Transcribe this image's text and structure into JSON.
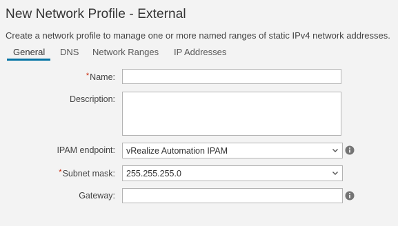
{
  "dialog": {
    "title": "New Network Profile - External",
    "subtitle": "Create a network profile to manage one or more named ranges of static IPv4 network addresses."
  },
  "tabs": [
    {
      "label": "General",
      "active": true
    },
    {
      "label": "DNS",
      "active": false
    },
    {
      "label": "Network Ranges",
      "active": false
    },
    {
      "label": "IP Addresses",
      "active": false
    }
  ],
  "form": {
    "name": {
      "label": "Name:",
      "required": true,
      "value": ""
    },
    "description": {
      "label": "Description:",
      "required": false,
      "value": ""
    },
    "ipam_endpoint": {
      "label": "IPAM endpoint:",
      "selected": "vRealize Automation IPAM",
      "info_icon": "info-icon"
    },
    "subnet_mask": {
      "label": "Subnet mask:",
      "required": true,
      "selected": "255.255.255.0"
    },
    "gateway": {
      "label": "Gateway:",
      "value": "",
      "info_icon": "info-icon"
    }
  },
  "colors": {
    "background": "#f3f3f3",
    "accent": "#0072a3",
    "required_marker": "#c92100",
    "info_icon": "#747474"
  },
  "required_marker": "*"
}
